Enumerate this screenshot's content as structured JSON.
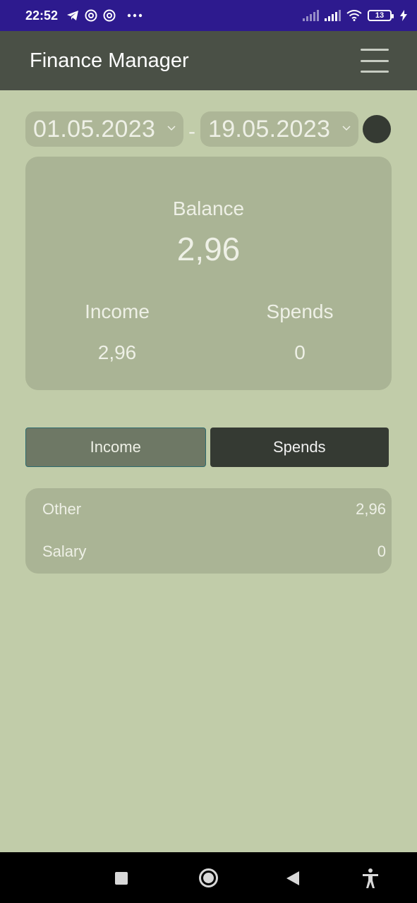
{
  "status_bar": {
    "time": "22:52",
    "battery": "13",
    "icons": [
      "telegram-icon",
      "at-icon",
      "at-icon",
      "more-icon",
      "signal-icon",
      "signal-icon",
      "wifi-icon",
      "battery-icon",
      "charging-icon"
    ]
  },
  "app_bar": {
    "title": "Finance Manager",
    "menu_icon": "hamburger-menu-icon"
  },
  "date_range": {
    "from": "01.05.2023",
    "separator": "-",
    "to": "19.05.2023"
  },
  "balance": {
    "label": "Balance",
    "value": "2,96",
    "income_label": "Income",
    "income_value": "2,96",
    "spends_label": "Spends",
    "spends_value": "0"
  },
  "tabs": [
    {
      "label": "Income",
      "active": true
    },
    {
      "label": "Spends",
      "active": false
    }
  ],
  "categories": [
    {
      "name": "Other",
      "amount": "2,96"
    },
    {
      "name": "Salary",
      "amount": "0"
    }
  ],
  "colors": {
    "background": "#c1cca9",
    "card": "#aab495",
    "app_bar": "#4a5046",
    "status_bar": "#2d1a8e",
    "dark": "#353a33",
    "active_tab": "#6e7865"
  }
}
